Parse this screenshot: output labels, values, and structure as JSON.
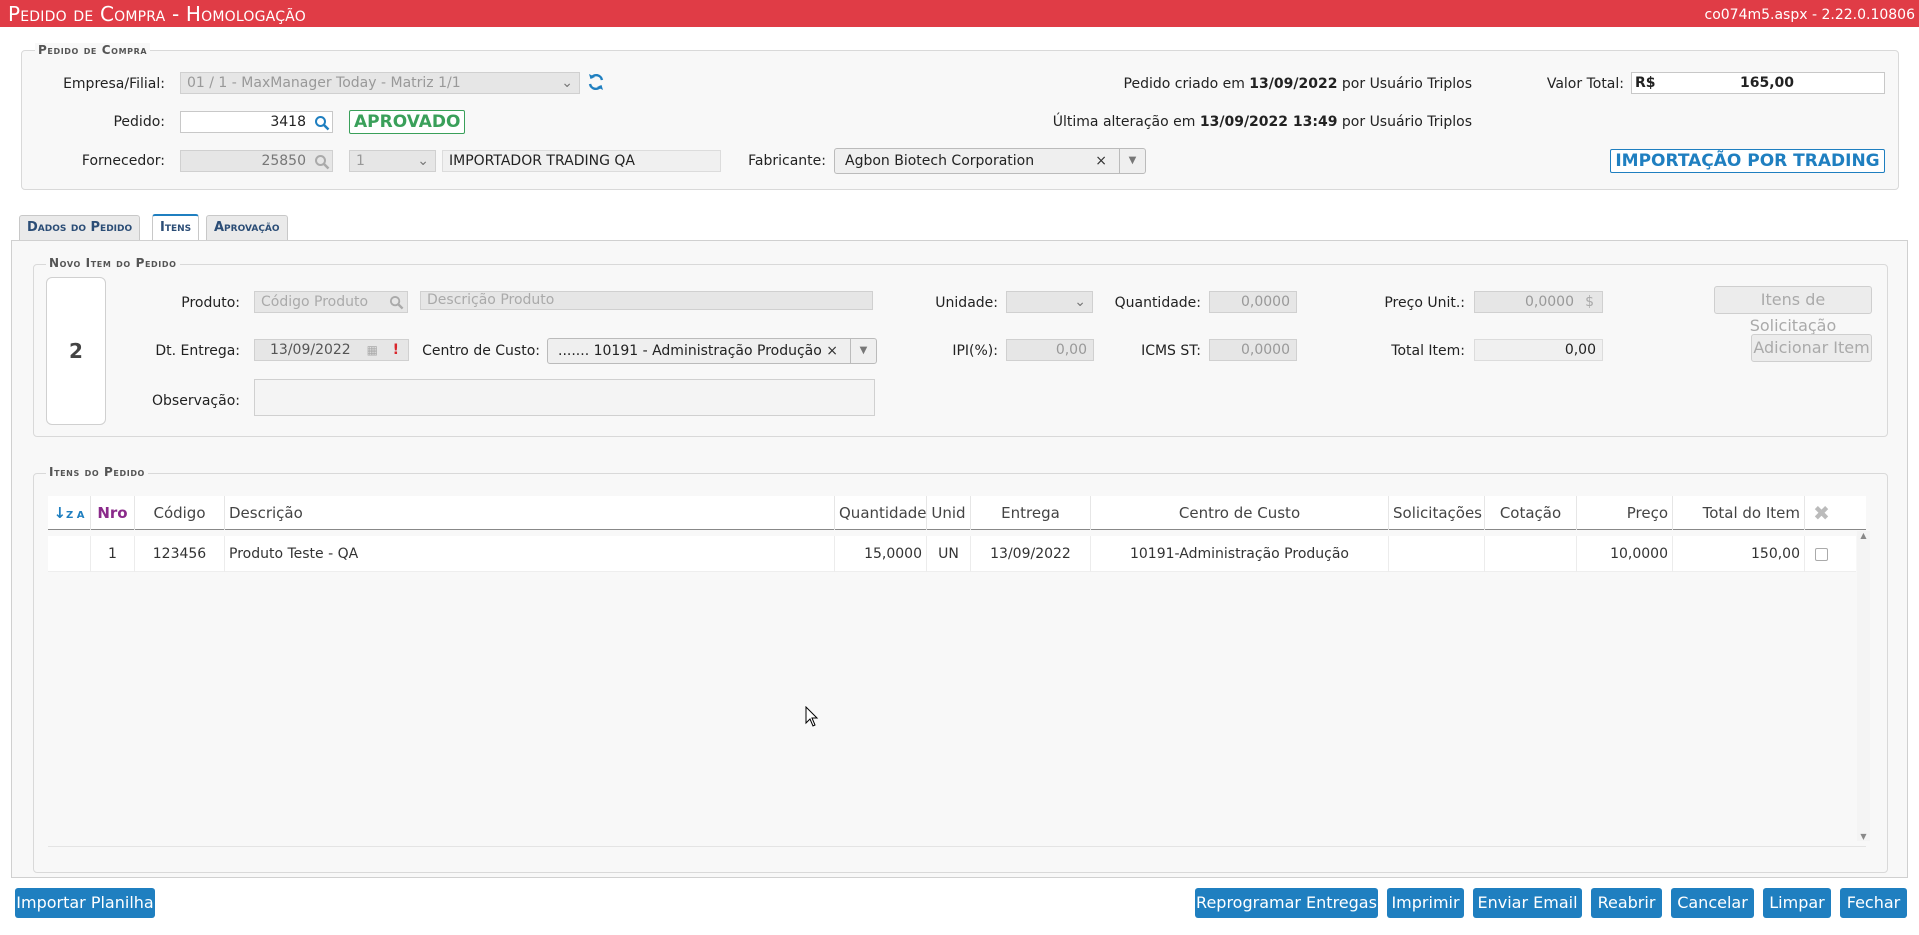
{
  "header": {
    "title": "Pedido de Compra  - Homologação",
    "version": "co074m5.aspx - 2.22.0.10806"
  },
  "pedido": {
    "legend": "Pedido de Compra",
    "empresa_label": "Empresa/Filial:",
    "empresa_value": "01 / 1 - MaxManager Today - Matriz 1/1",
    "pedido_label": "Pedido:",
    "pedido_value": "3418",
    "status": "APROVADO",
    "fornecedor_label": "Fornecedor:",
    "fornecedor_code": "25850",
    "fornecedor_seq": "1",
    "fornecedor_name": "IMPORTADOR TRADING QA",
    "fabricante_label": "Fabricante:",
    "fabricante_value": "Agbon Biotech Corporation",
    "created_prefix": "Pedido criado em",
    "created_date": "13/09/2022",
    "created_by": "por Usuário Triplos",
    "altered_prefix": "Última alteração em",
    "altered_date": "13/09/2022 13:49",
    "altered_by": "por Usuário Triplos",
    "valor_label": "Valor Total:",
    "valor_currency": "R$",
    "valor_value": "165,00",
    "trading_badge": "IMPORTAÇÃO POR TRADING"
  },
  "tabs": [
    {
      "label": "Dados do Pedido"
    },
    {
      "label": "Itens"
    },
    {
      "label": "Aprovação"
    }
  ],
  "novo_item": {
    "legend": "Novo Item do Pedido",
    "item_number": "2",
    "produto_label": "Produto:",
    "produto_code_placeholder": "Código Produto",
    "produto_desc_placeholder": "Descrição Produto",
    "unidade_label": "Unidade:",
    "quantidade_label": "Quantidade:",
    "quantidade_value": "0,0000",
    "preco_label": "Preço Unit.:",
    "preco_value": "0,0000",
    "preco_symbol": "$",
    "dt_entrega_label": "Dt. Entrega:",
    "dt_entrega_value": "13/09/2022",
    "centro_label": "Centro de Custo:",
    "centro_value": "....... 10191 - Administração Produção",
    "ipi_label": "IPI(%):",
    "ipi_value": "0,00",
    "icms_label": "ICMS ST:",
    "icms_value": "0,0000",
    "total_label": "Total Item:",
    "total_value": "0,00",
    "obs_label": "Observação:",
    "itens_solicitacao_btn": "Itens de Solicitação",
    "adicionar_item_btn": "Adicionar Item"
  },
  "itens": {
    "legend": "Itens do Pedido",
    "columns": [
      "Nro",
      "Código",
      "Descrição",
      "Quantidade",
      "Unid",
      "Entrega",
      "Centro de Custo",
      "Solicitações",
      "Cotação",
      "Preço",
      "Total do Item"
    ],
    "rows": [
      {
        "nro": "1",
        "codigo": "123456",
        "descricao": "Produto Teste - QA",
        "quantidade": "15,0000",
        "unid": "UN",
        "entrega": "13/09/2022",
        "centro": "10191-Administração Produção",
        "solicitacoes": "",
        "cotacao": "",
        "preco": "10,0000",
        "total": "150,00"
      }
    ]
  },
  "footer": {
    "importar": "Importar Planilha",
    "reprogramar": "Reprogramar Entregas",
    "imprimir": "Imprimir",
    "enviar_email": "Enviar Email",
    "reabrir": "Reabrir",
    "cancelar": "Cancelar",
    "limpar": "Limpar",
    "fechar": "Fechar"
  },
  "colors": {
    "header": "#e03c46",
    "accent": "#1f7fc0",
    "approved": "#3aa05a"
  }
}
